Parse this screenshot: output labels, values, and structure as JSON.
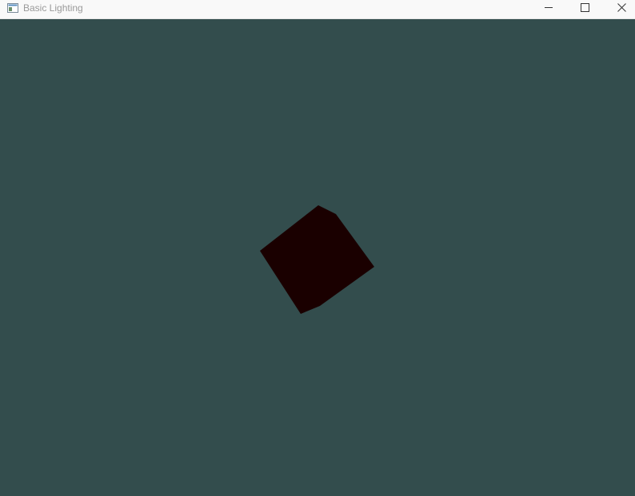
{
  "window": {
    "title": "Basic Lighting",
    "app_icon": "window-app-icon",
    "controls": {
      "minimize_icon": "minimize-icon",
      "maximize_icon": "maximize-icon",
      "close_icon": "close-icon"
    }
  },
  "scene": {
    "background_color": "#334d4d",
    "object": "cube",
    "object_color": "#1a0000"
  }
}
